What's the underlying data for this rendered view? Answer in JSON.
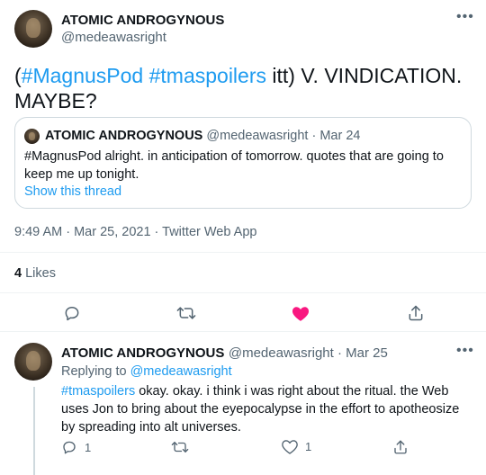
{
  "main_tweet": {
    "author_name": "ATOMIC ANDROGYNOUS",
    "author_handle": "@medeawasright",
    "text_parts": [
      "(",
      "#MagnusPod",
      " ",
      "#tmaspoilers",
      " itt) V. VINDICATION. MAYBE?"
    ],
    "timestamp": "9:49 AM · Mar 25, 2021 · Twitter Web App",
    "likes_count": "4",
    "likes_label": " Likes"
  },
  "quoted_tweet": {
    "author_name": "ATOMIC ANDROGYNOUS",
    "author_handle": "@medeawasright",
    "date": " · Mar 24",
    "text": "#MagnusPod alright. in anticipation of tomorrow. quotes that are going to keep me up tonight.",
    "show_thread": "Show this thread"
  },
  "reply_tweet": {
    "author_name": "ATOMIC ANDROGYNOUS",
    "author_handle": "@medeawasright",
    "date": " · Mar 25",
    "replying_to_label": "Replying to ",
    "replying_to_handle": "@medeawasright",
    "hashtag": "#tmaspoilers",
    "text": " okay. okay. i think i was right about the ritual. the Web uses Jon to bring about the eyepocalypse in the effort to apotheosize by spreading into alt universes.",
    "reply_count": "1",
    "like_count": "1"
  },
  "icons": {
    "more": "more-icon",
    "reply": "reply-icon",
    "retweet": "retweet-icon",
    "like": "heart-icon",
    "share": "share-icon"
  },
  "colors": {
    "accent": "#1d9bf0",
    "liked": "#f91880",
    "secondary_text": "#536471"
  }
}
